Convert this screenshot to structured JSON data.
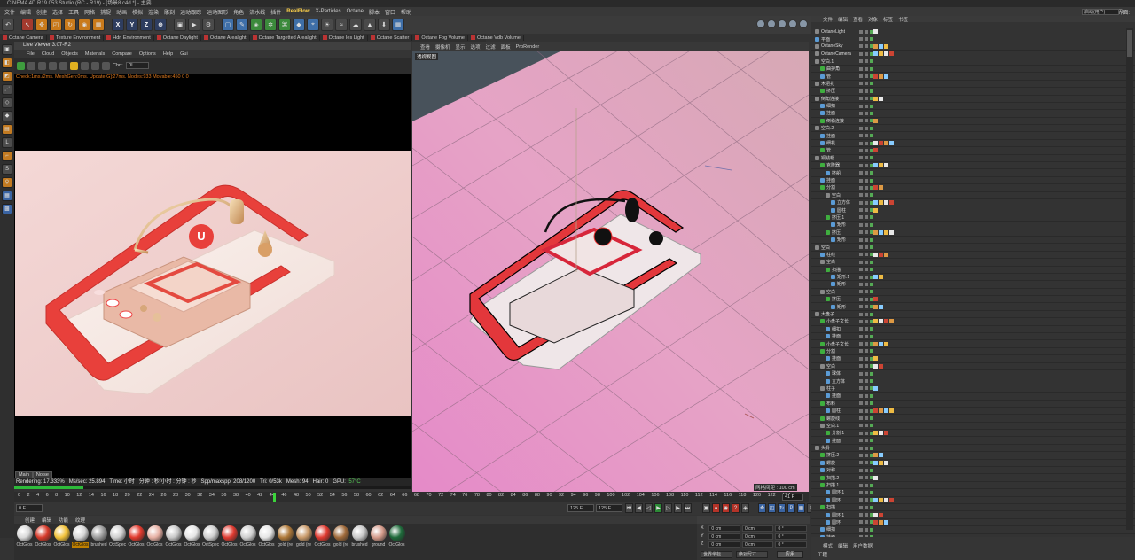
{
  "app": {
    "title": "CINEMA 4D R19.053 Studio (RC - R19) - [场景8.c4d *] - 主要",
    "menu": [
      "文件",
      "编辑",
      "创建",
      "选择",
      "工具",
      "网格",
      "捕捉",
      "动画",
      "模拟",
      "渲染",
      "雕刻",
      "运动跟踪",
      "运动图形",
      "角色",
      "流水线",
      "插件",
      "RealFlow",
      "X-Particles",
      "Octane",
      "脚本",
      "窗口",
      "帮助"
    ],
    "layout_label": "界面:",
    "layout_value": "启动(用户)"
  },
  "octane_toolbar": [
    "Octane Camera",
    "Texture Environment",
    "Hdri Environment",
    "Octane Daylight",
    "Octane Arealight",
    "Octane Targetted Arealight",
    "Octane Ies Light",
    "Octane Scatter",
    "Octane Fog Volume",
    "Octane Vdb Volume"
  ],
  "live_viewer": {
    "title": "Live Viewer 3.07-R2",
    "menu": [
      "File",
      "Cloud",
      "Objects",
      "Materials",
      "Compare",
      "Options",
      "Help",
      "Gui"
    ],
    "channel_label": "Chn:",
    "channel_value": "DL",
    "status_line": "Check:1ms./2ms. MeshGen:0ms. Update[G]:27ms. Nodes:933 Movable:450 0 0",
    "tabs": [
      "Main",
      "Noise"
    ],
    "render_stats": {
      "rendering": "Rendering: 17.333%",
      "ms_sec": "Ms/sec: 25.894",
      "time": "Time: 小时 : 分钟 : 秒/小时 : 分钟 : 秒",
      "spp": "Spp/maxspp: 208/1200",
      "tri": "Tri: 0/53k",
      "mesh": "Mesh: 94",
      "hair": "Hair: 0",
      "gpu_label": "GPU:",
      "gpu_temp": "57°C"
    },
    "progress": 0.173
  },
  "viewport": {
    "menu": [
      "查看",
      "摄像机",
      "显示",
      "选项",
      "过滤",
      "面板",
      "ProRender"
    ],
    "label": "透视视图",
    "grid_label": "网格间距 : 100 cm"
  },
  "timeline": {
    "ticks": [
      "0",
      "2",
      "4",
      "6",
      "8",
      "10",
      "12",
      "14",
      "16",
      "18",
      "20",
      "22",
      "24",
      "26",
      "28",
      "30",
      "32",
      "34",
      "36",
      "38",
      "40",
      "42",
      "44",
      "46",
      "48",
      "50",
      "52",
      "54",
      "56",
      "58",
      "60",
      "62",
      "64",
      "66",
      "68",
      "70",
      "72",
      "74",
      "76",
      "78",
      "80",
      "82",
      "84",
      "86",
      "88",
      "90",
      "92",
      "94",
      "96",
      "98",
      "100",
      "102",
      "104",
      "106",
      "108",
      "110",
      "112",
      "114",
      "116",
      "118",
      "120",
      "122",
      "124"
    ],
    "frame_value": "41 F",
    "current_frame": "0 F",
    "end_frame": "125 F",
    "end_frame2": "125 F",
    "current": 41
  },
  "materials": {
    "menu": [
      "创建",
      "编辑",
      "功能",
      "纹理"
    ],
    "items": [
      {
        "label": "OctGlos",
        "color": "#d9d9d9"
      },
      {
        "label": "OctGlos",
        "color": "#d73a2a"
      },
      {
        "label": "OctGlos",
        "color": "#f2c23a"
      },
      {
        "label": "OctGlos",
        "color": "#d8d8d8",
        "selected": true
      },
      {
        "label": "brushed",
        "color": "#9c9c9c"
      },
      {
        "label": "OctSpec",
        "color": "#cfcfcf"
      },
      {
        "label": "OctGlos",
        "color": "#e23a2e"
      },
      {
        "label": "OctGlos",
        "color": "#e7b0a4"
      },
      {
        "label": "OctGlos",
        "color": "#c7c7c7"
      },
      {
        "label": "OctGlos",
        "color": "#e6e6e6"
      },
      {
        "label": "OctSpec",
        "color": "#cfcfcf"
      },
      {
        "label": "OctGlos",
        "color": "#e03a30"
      },
      {
        "label": "OctGlos",
        "color": "#cfcfcf"
      },
      {
        "label": "OctGlos",
        "color": "#e6e6e6"
      },
      {
        "label": "gold (re",
        "color": "#b07a3a"
      },
      {
        "label": "gold (re",
        "color": "#c99a6a"
      },
      {
        "label": "OctGlos",
        "color": "#e03a30"
      },
      {
        "label": "gold (re",
        "color": "#a06a3a"
      },
      {
        "label": "brushed",
        "color": "#c8c8c8"
      },
      {
        "label": "ground",
        "color": "#d49a8a"
      },
      {
        "label": "OctGlos",
        "color": "#1e6a3a"
      }
    ]
  },
  "coords": {
    "rows": [
      {
        "axis": "X",
        "a": "0 cm",
        "b": "0 cm",
        "c": "0 °"
      },
      {
        "axis": "Y",
        "a": "0 cm",
        "b": "0 cm",
        "c": "0 °"
      },
      {
        "axis": "Z",
        "a": "0 cm",
        "b": "0 cm",
        "c": "0 °"
      }
    ],
    "mode1": "世界坐标",
    "mode2": "绝对尺寸",
    "apply": "应用"
  },
  "object_manager": {
    "menu": [
      "文件",
      "编辑",
      "查看",
      "对象",
      "标签",
      "书签"
    ],
    "rows": [
      {
        "name": "OctaneLight",
        "type": "n",
        "indent": 0
      },
      {
        "name": "平面",
        "type": "b",
        "indent": 0
      },
      {
        "name": "OctaneSky",
        "type": "n",
        "indent": 0
      },
      {
        "name": "OctaneCamera",
        "type": "n",
        "indent": 0
      },
      {
        "name": "空白.1",
        "type": "n",
        "indent": 0
      },
      {
        "name": "曲护角",
        "type": "g",
        "indent": 1
      },
      {
        "name": "管",
        "type": "b",
        "indent": 1
      },
      {
        "name": "木把扎",
        "type": "n",
        "indent": 0
      },
      {
        "name": "挤压",
        "type": "g",
        "indent": 1
      },
      {
        "name": "倒角连接",
        "type": "n",
        "indent": 0
      },
      {
        "name": "细扣",
        "type": "b",
        "indent": 1
      },
      {
        "name": "挂面",
        "type": "b",
        "indent": 1
      },
      {
        "name": "倒稳连接",
        "type": "g",
        "indent": 1
      },
      {
        "name": "空白.2",
        "type": "n",
        "indent": 0
      },
      {
        "name": "挂面",
        "type": "b",
        "indent": 1
      },
      {
        "name": "细机",
        "type": "b",
        "indent": 1
      },
      {
        "name": "管",
        "type": "g",
        "indent": 1
      },
      {
        "name": "铜钱帽",
        "type": "n",
        "indent": 0
      },
      {
        "name": "克隆器",
        "type": "g",
        "indent": 1
      },
      {
        "name": "挤船",
        "type": "b",
        "indent": 2
      },
      {
        "name": "挂面",
        "type": "b",
        "indent": 1
      },
      {
        "name": "分割",
        "type": "g",
        "indent": 1
      },
      {
        "name": "空白",
        "type": "n",
        "indent": 2
      },
      {
        "name": "立方体",
        "type": "b",
        "indent": 3
      },
      {
        "name": "圆柱",
        "type": "b",
        "indent": 3
      },
      {
        "name": "挤压.1",
        "type": "g",
        "indent": 2
      },
      {
        "name": "矩形",
        "type": "b",
        "indent": 3
      },
      {
        "name": "挤压",
        "type": "g",
        "indent": 2
      },
      {
        "name": "矩形",
        "type": "b",
        "indent": 3
      },
      {
        "name": "空白",
        "type": "n",
        "indent": 0
      },
      {
        "name": "柱线",
        "type": "b",
        "indent": 1
      },
      {
        "name": "空白",
        "type": "n",
        "indent": 1
      },
      {
        "name": "扫描",
        "type": "g",
        "indent": 2
      },
      {
        "name": "矩形.1",
        "type": "b",
        "indent": 3
      },
      {
        "name": "矩形",
        "type": "b",
        "indent": 3
      },
      {
        "name": "空白",
        "type": "n",
        "indent": 1
      },
      {
        "name": "挤压",
        "type": "g",
        "indent": 2
      },
      {
        "name": "矩形",
        "type": "b",
        "indent": 3
      },
      {
        "name": "大盘子",
        "type": "n",
        "indent": 0
      },
      {
        "name": "小盘子文长",
        "type": "g",
        "indent": 1
      },
      {
        "name": "细扣",
        "type": "b",
        "indent": 2
      },
      {
        "name": "挂面",
        "type": "b",
        "indent": 2
      },
      {
        "name": "小盘子文长",
        "type": "g",
        "indent": 1
      },
      {
        "name": "分割",
        "type": "g",
        "indent": 1
      },
      {
        "name": "挂面",
        "type": "b",
        "indent": 2
      },
      {
        "name": "空白",
        "type": "n",
        "indent": 1
      },
      {
        "name": "球体",
        "type": "b",
        "indent": 2
      },
      {
        "name": "立方体",
        "type": "b",
        "indent": 2
      },
      {
        "name": "柱子",
        "type": "n",
        "indent": 1
      },
      {
        "name": "挂面",
        "type": "b",
        "indent": 2
      },
      {
        "name": "布料",
        "type": "g",
        "indent": 1
      },
      {
        "name": "圆柱",
        "type": "b",
        "indent": 2
      },
      {
        "name": "螺旋线",
        "type": "g",
        "indent": 1
      },
      {
        "name": "空白.1",
        "type": "n",
        "indent": 1
      },
      {
        "name": "分割.1",
        "type": "g",
        "indent": 2
      },
      {
        "name": "挂面",
        "type": "b",
        "indent": 2
      },
      {
        "name": "头骨",
        "type": "n",
        "indent": 0
      },
      {
        "name": "挤压.2",
        "type": "g",
        "indent": 1
      },
      {
        "name": "螺旋",
        "type": "b",
        "indent": 1
      },
      {
        "name": "对称",
        "type": "b",
        "indent": 1
      },
      {
        "name": "扫描.2",
        "type": "g",
        "indent": 1
      },
      {
        "name": "扫描.1",
        "type": "g",
        "indent": 1
      },
      {
        "name": "圆环.1",
        "type": "b",
        "indent": 2
      },
      {
        "name": "圆环",
        "type": "b",
        "indent": 2
      },
      {
        "name": "扫描",
        "type": "g",
        "indent": 1
      },
      {
        "name": "圆环.1",
        "type": "b",
        "indent": 2
      },
      {
        "name": "圆环",
        "type": "b",
        "indent": 2
      },
      {
        "name": "细扣",
        "type": "b",
        "indent": 1
      },
      {
        "name": "挂面",
        "type": "b",
        "indent": 1
      },
      {
        "name": "细扣",
        "type": "b",
        "indent": 1
      }
    ]
  },
  "attributes": {
    "menu": [
      "模式",
      "编辑",
      "用户数据"
    ],
    "project": "工程"
  }
}
